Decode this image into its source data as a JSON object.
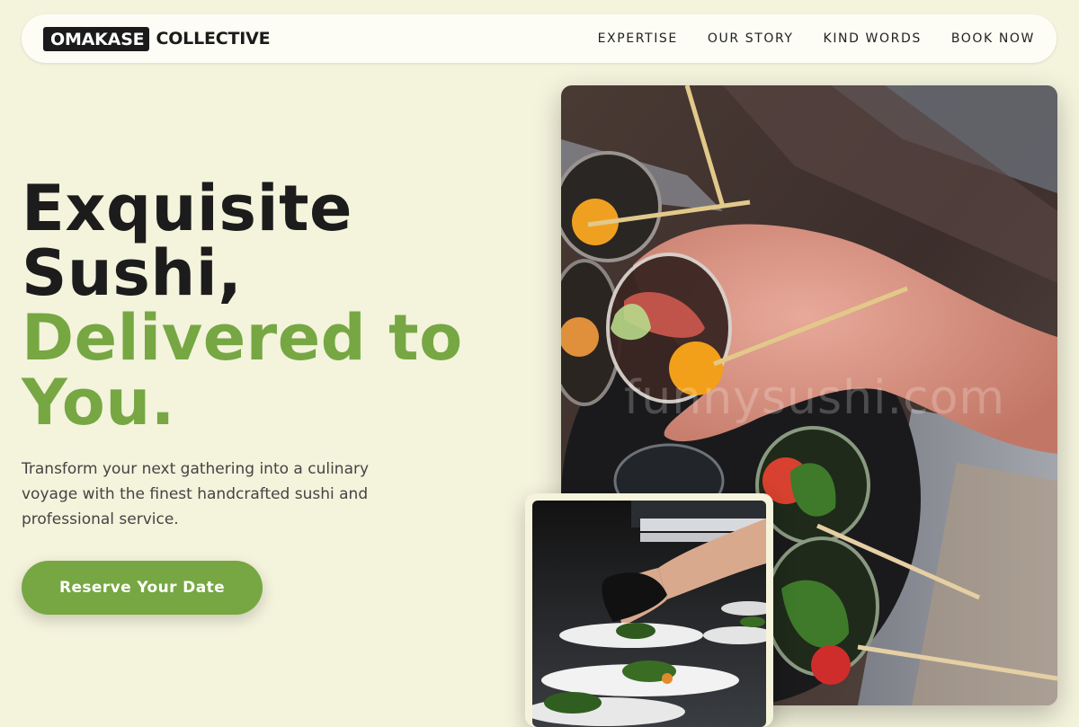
{
  "nav": {
    "brand_box": "OMAKASE",
    "brand_rest": "COLLECTIVE",
    "links": [
      "EXPERTISE",
      "OUR STORY",
      "KIND WORDS",
      "BOOK NOW"
    ]
  },
  "hero": {
    "title_line1": "Exquisite",
    "title_line2": "Sushi,",
    "accent_line1": "Delivered to",
    "accent_line2": "You.",
    "subtitle": "Transform your next gathering into a culinary voyage with the finest handcrafted sushi and professional service.",
    "cta_label": "Reserve Your Date"
  },
  "images": {
    "main_watermark": "funnysushi.com"
  },
  "colors": {
    "background": "#f4f3dc",
    "accent": "#76a743",
    "text": "#1c1c1c"
  }
}
